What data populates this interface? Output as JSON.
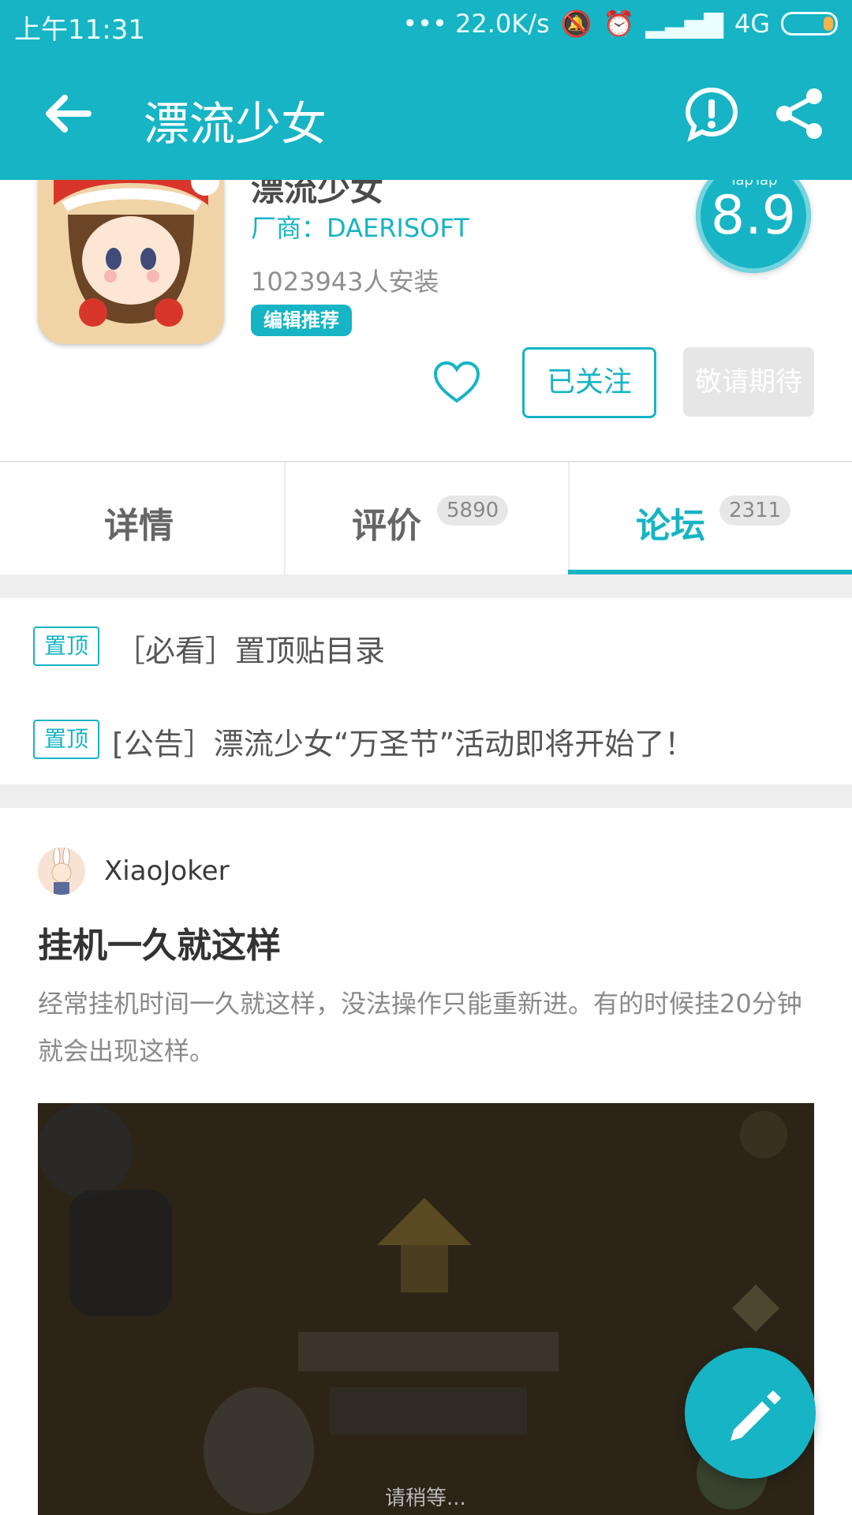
{
  "status_bar": {
    "time": "上午11:31",
    "network_speed": "••• 22.0K/s",
    "network_type": "4G"
  },
  "app_bar": {
    "title": "漂流少女",
    "back_icon": "arrow-left-icon",
    "report_icon": "alert-icon",
    "share_icon": "share-icon"
  },
  "app_info": {
    "name": "漂流少女",
    "vendor": "厂商：DAERISOFT",
    "installs": "1023943人安装",
    "tag": "编辑推荐",
    "score_brand": "TapTap",
    "score": "8.9",
    "follow_label": "已关注",
    "await_label": "敬请期待"
  },
  "tabs": [
    {
      "label": "详情",
      "badge": ""
    },
    {
      "label": "评价",
      "badge": "5890"
    },
    {
      "label": "论坛",
      "badge": "2311",
      "active": true
    }
  ],
  "pinned": [
    {
      "badge": "置顶",
      "text": "［必看］置顶贴目录"
    },
    {
      "badge": "置顶",
      "text": "[公告］漂流少女“万圣节”活动即将开始了！"
    }
  ],
  "post": {
    "author": "XiaoJoker",
    "title": "挂机一久就这样",
    "body": "经常挂机时间一久就这样，没法操作只能重新进。有的时候挂20分钟就会出现这样。",
    "image_caption": "请稍等..."
  },
  "colors": {
    "accent": "#16b4c4",
    "muted": "#8a8a8a"
  }
}
